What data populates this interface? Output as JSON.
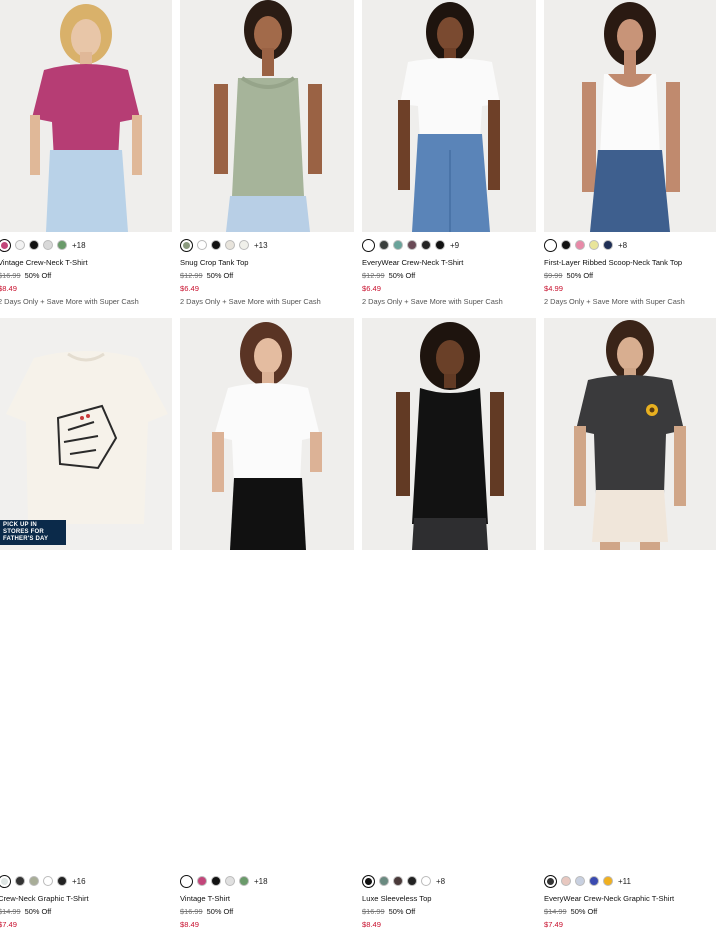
{
  "products": [
    {
      "name": "Vintage Crew-Neck T-Shirt",
      "orig": "$16.99",
      "off": "50% Off",
      "now": "$8.49",
      "promo": "2 Days Only + Save More with Super Cash",
      "swatches": [
        "#c2467a",
        "#f2f2f2",
        "#111111",
        "#d9d9d9",
        "#6a9a6a"
      ],
      "more": "+18"
    },
    {
      "name": "Snug Crop Tank Top",
      "orig": "$12.99",
      "off": "50% Off",
      "now": "$6.49",
      "promo": "2 Days Only + Save More with Super Cash",
      "swatches": [
        "#8a9a7e",
        "#ffffff",
        "#111111",
        "#e8e4dc",
        "#f0f0ea"
      ],
      "more": "+13"
    },
    {
      "name": "EveryWear Crew-Neck T-Shirt",
      "orig": "$12.99",
      "off": "50% Off",
      "now": "$6.49",
      "promo": "2 Days Only + Save More with Super Cash",
      "swatches": [
        "#ffffff",
        "#3a3f3d",
        "#6aa39a",
        "#6a4a56",
        "#222222",
        "#111111"
      ],
      "more": "+9"
    },
    {
      "name": "First-Layer Ribbed Scoop-Neck Tank Top",
      "orig": "$9.99",
      "off": "50% Off",
      "now": "$4.99",
      "promo": "2 Days Only + Save More with Super Cash",
      "swatches": [
        "#ffffff",
        "#111111",
        "#e88aa8",
        "#e8e49a",
        "#1f2f55"
      ],
      "more": "+8"
    },
    {
      "name": "Crew-Neck Graphic T-Shirt",
      "orig": "$14.99",
      "off": "50% Off",
      "now": "$7.49",
      "promo": "",
      "swatches": [
        "#dfe6e4",
        "#333333",
        "#a8ad98",
        "#ffffff",
        "#222222"
      ],
      "more": "+16",
      "badge": "PICK UP IN STORES FOR FATHER'S DAY"
    },
    {
      "name": "Vintage T-Shirt",
      "orig": "$16.99",
      "off": "50% Off",
      "now": "$8.49",
      "promo": "",
      "swatches": [
        "#ffffff",
        "#c2467a",
        "#111111",
        "#e0e0e0",
        "#6a9a6a"
      ],
      "more": "+18"
    },
    {
      "name": "Luxe Sleeveless Top",
      "orig": "$16.99",
      "off": "50% Off",
      "now": "$8.49",
      "promo": "",
      "swatches": [
        "#111111",
        "#6a8a80",
        "#4a3a3a",
        "#222222",
        "#ffffff"
      ],
      "more": "+8"
    },
    {
      "name": "EveryWear Crew-Neck Graphic T-Shirt",
      "orig": "$14.99",
      "off": "50% Off",
      "now": "$7.49",
      "promo": "",
      "swatches": [
        "#333333",
        "#e8c8c0",
        "#c8d0e0",
        "#3a4ab0",
        "#f0b020"
      ],
      "more": "+11"
    }
  ]
}
